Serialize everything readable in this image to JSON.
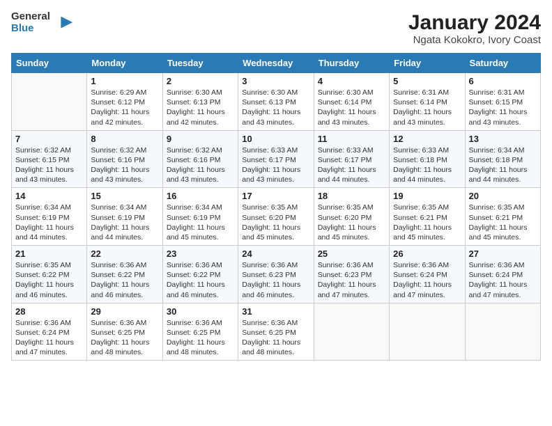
{
  "header": {
    "logo_line1": "General",
    "logo_line2": "Blue",
    "title": "January 2024",
    "subtitle": "Ngata Kokokro, Ivory Coast"
  },
  "days_of_week": [
    "Sunday",
    "Monday",
    "Tuesday",
    "Wednesday",
    "Thursday",
    "Friday",
    "Saturday"
  ],
  "weeks": [
    [
      {
        "day": "",
        "text": ""
      },
      {
        "day": "1",
        "text": "Sunrise: 6:29 AM\nSunset: 6:12 PM\nDaylight: 11 hours\nand 42 minutes."
      },
      {
        "day": "2",
        "text": "Sunrise: 6:30 AM\nSunset: 6:13 PM\nDaylight: 11 hours\nand 42 minutes."
      },
      {
        "day": "3",
        "text": "Sunrise: 6:30 AM\nSunset: 6:13 PM\nDaylight: 11 hours\nand 43 minutes."
      },
      {
        "day": "4",
        "text": "Sunrise: 6:30 AM\nSunset: 6:14 PM\nDaylight: 11 hours\nand 43 minutes."
      },
      {
        "day": "5",
        "text": "Sunrise: 6:31 AM\nSunset: 6:14 PM\nDaylight: 11 hours\nand 43 minutes."
      },
      {
        "day": "6",
        "text": "Sunrise: 6:31 AM\nSunset: 6:15 PM\nDaylight: 11 hours\nand 43 minutes."
      }
    ],
    [
      {
        "day": "7",
        "text": "Sunrise: 6:32 AM\nSunset: 6:15 PM\nDaylight: 11 hours\nand 43 minutes."
      },
      {
        "day": "8",
        "text": "Sunrise: 6:32 AM\nSunset: 6:16 PM\nDaylight: 11 hours\nand 43 minutes."
      },
      {
        "day": "9",
        "text": "Sunrise: 6:32 AM\nSunset: 6:16 PM\nDaylight: 11 hours\nand 43 minutes."
      },
      {
        "day": "10",
        "text": "Sunrise: 6:33 AM\nSunset: 6:17 PM\nDaylight: 11 hours\nand 43 minutes."
      },
      {
        "day": "11",
        "text": "Sunrise: 6:33 AM\nSunset: 6:17 PM\nDaylight: 11 hours\nand 44 minutes."
      },
      {
        "day": "12",
        "text": "Sunrise: 6:33 AM\nSunset: 6:18 PM\nDaylight: 11 hours\nand 44 minutes."
      },
      {
        "day": "13",
        "text": "Sunrise: 6:34 AM\nSunset: 6:18 PM\nDaylight: 11 hours\nand 44 minutes."
      }
    ],
    [
      {
        "day": "14",
        "text": "Sunrise: 6:34 AM\nSunset: 6:19 PM\nDaylight: 11 hours\nand 44 minutes."
      },
      {
        "day": "15",
        "text": "Sunrise: 6:34 AM\nSunset: 6:19 PM\nDaylight: 11 hours\nand 44 minutes."
      },
      {
        "day": "16",
        "text": "Sunrise: 6:34 AM\nSunset: 6:19 PM\nDaylight: 11 hours\nand 45 minutes."
      },
      {
        "day": "17",
        "text": "Sunrise: 6:35 AM\nSunset: 6:20 PM\nDaylight: 11 hours\nand 45 minutes."
      },
      {
        "day": "18",
        "text": "Sunrise: 6:35 AM\nSunset: 6:20 PM\nDaylight: 11 hours\nand 45 minutes."
      },
      {
        "day": "19",
        "text": "Sunrise: 6:35 AM\nSunset: 6:21 PM\nDaylight: 11 hours\nand 45 minutes."
      },
      {
        "day": "20",
        "text": "Sunrise: 6:35 AM\nSunset: 6:21 PM\nDaylight: 11 hours\nand 45 minutes."
      }
    ],
    [
      {
        "day": "21",
        "text": "Sunrise: 6:35 AM\nSunset: 6:22 PM\nDaylight: 11 hours\nand 46 minutes."
      },
      {
        "day": "22",
        "text": "Sunrise: 6:36 AM\nSunset: 6:22 PM\nDaylight: 11 hours\nand 46 minutes."
      },
      {
        "day": "23",
        "text": "Sunrise: 6:36 AM\nSunset: 6:22 PM\nDaylight: 11 hours\nand 46 minutes."
      },
      {
        "day": "24",
        "text": "Sunrise: 6:36 AM\nSunset: 6:23 PM\nDaylight: 11 hours\nand 46 minutes."
      },
      {
        "day": "25",
        "text": "Sunrise: 6:36 AM\nSunset: 6:23 PM\nDaylight: 11 hours\nand 47 minutes."
      },
      {
        "day": "26",
        "text": "Sunrise: 6:36 AM\nSunset: 6:24 PM\nDaylight: 11 hours\nand 47 minutes."
      },
      {
        "day": "27",
        "text": "Sunrise: 6:36 AM\nSunset: 6:24 PM\nDaylight: 11 hours\nand 47 minutes."
      }
    ],
    [
      {
        "day": "28",
        "text": "Sunrise: 6:36 AM\nSunset: 6:24 PM\nDaylight: 11 hours\nand 47 minutes."
      },
      {
        "day": "29",
        "text": "Sunrise: 6:36 AM\nSunset: 6:25 PM\nDaylight: 11 hours\nand 48 minutes."
      },
      {
        "day": "30",
        "text": "Sunrise: 6:36 AM\nSunset: 6:25 PM\nDaylight: 11 hours\nand 48 minutes."
      },
      {
        "day": "31",
        "text": "Sunrise: 6:36 AM\nSunset: 6:25 PM\nDaylight: 11 hours\nand 48 minutes."
      },
      {
        "day": "",
        "text": ""
      },
      {
        "day": "",
        "text": ""
      },
      {
        "day": "",
        "text": ""
      }
    ]
  ]
}
